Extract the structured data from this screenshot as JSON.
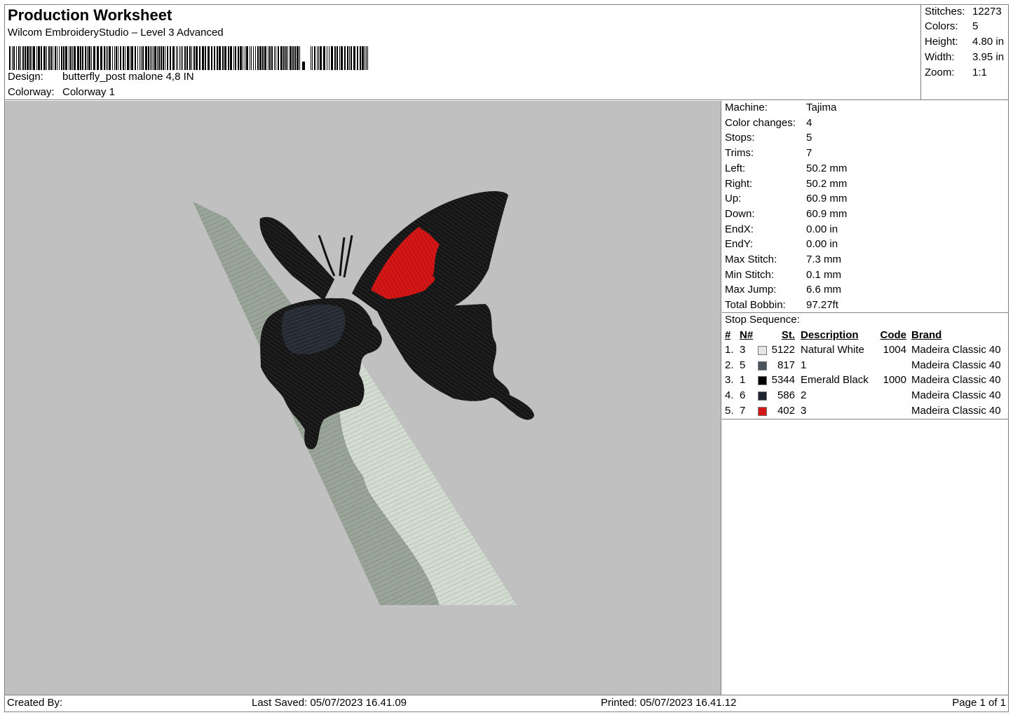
{
  "header": {
    "title": "Production Worksheet",
    "subtitle": "Wilcom EmbroideryStudio – Level 3 Advanced",
    "design_label": "Design:",
    "design_value": "butterfly_post malone 4,8 IN",
    "colorway_label": "Colorway:",
    "colorway_value": "Colorway 1"
  },
  "summary": [
    {
      "label": "Stitches:",
      "value": "12273"
    },
    {
      "label": "Colors:",
      "value": "5"
    },
    {
      "label": "Height:",
      "value": "4.80 in"
    },
    {
      "label": "Width:",
      "value": "3.95 in"
    },
    {
      "label": "Zoom:",
      "value": "1:1"
    }
  ],
  "machine_info": [
    {
      "label": "Machine:",
      "value": "Tajima"
    },
    {
      "label": "Color changes:",
      "value": "4"
    },
    {
      "label": "Stops:",
      "value": "5"
    },
    {
      "label": "Trims:",
      "value": "7"
    },
    {
      "label": "Left:",
      "value": "50.2 mm"
    },
    {
      "label": "Right:",
      "value": "50.2 mm"
    },
    {
      "label": "Up:",
      "value": "60.9 mm"
    },
    {
      "label": "Down:",
      "value": "60.9 mm"
    },
    {
      "label": "EndX:",
      "value": "0.00 in"
    },
    {
      "label": "EndY:",
      "value": "0.00 in"
    },
    {
      "label": "Max Stitch:",
      "value": "7.3 mm"
    },
    {
      "label": "Min Stitch:",
      "value": "0.1 mm"
    },
    {
      "label": "Max Jump:",
      "value": "6.6 mm"
    },
    {
      "label": "Total Bobbin:",
      "value": "97.27ft"
    }
  ],
  "stop_sequence": {
    "heading": "Stop Sequence:",
    "columns": {
      "num": "#",
      "n": "N#",
      "st": "St.",
      "desc": "Description",
      "code": "Code",
      "brand": "Brand"
    },
    "rows": [
      {
        "num": "1.",
        "n": "3",
        "color": "#e6e6e6",
        "st": "5122",
        "desc": "Natural White",
        "code": "1004",
        "brand": "Madeira Classic 40"
      },
      {
        "num": "2.",
        "n": "5",
        "color": "#4a5560",
        "st": "817",
        "desc": "1",
        "code": "",
        "brand": "Madeira Classic 40"
      },
      {
        "num": "3.",
        "n": "1",
        "color": "#000000",
        "st": "5344",
        "desc": "Emerald Black",
        "code": "1000",
        "brand": "Madeira Classic 40"
      },
      {
        "num": "4.",
        "n": "6",
        "color": "#1e2430",
        "st": "586",
        "desc": "2",
        "code": "",
        "brand": "Madeira Classic 40"
      },
      {
        "num": "5.",
        "n": "7",
        "color": "#d41616",
        "st": "402",
        "desc": "3",
        "code": "",
        "brand": "Madeira Classic 40"
      }
    ]
  },
  "footer": {
    "created_by": "Created By:",
    "last_saved": "Last Saved: 05/07/2023 16.41.09",
    "printed": "Printed: 05/07/2023 16.41.12",
    "page": "Page 1 of 1"
  },
  "preview": {
    "background": "#c0c0c0",
    "colors": {
      "light": "#d3dcd0",
      "shade": "#8f9a8e",
      "black": "#141414",
      "dark_blue": "#2a2f38",
      "red": "#d41616"
    }
  }
}
